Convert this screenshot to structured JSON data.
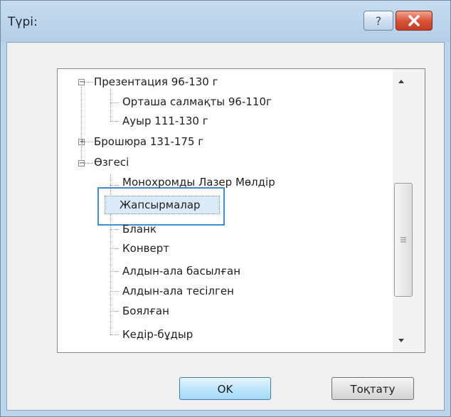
{
  "dialog": {
    "title": "Түрі:",
    "help_label": "?",
    "close_icon": "close-x-icon"
  },
  "tree": {
    "nodes": [
      {
        "label": "Презентация 96-130 г",
        "expander": "−"
      },
      {
        "label": "Орташа салмақты 96-110г"
      },
      {
        "label": "Ауыр 111-130 г"
      },
      {
        "label": "Брошюра 131-175 г",
        "expander": "+"
      },
      {
        "label": "Өзгесі",
        "expander": "−"
      },
      {
        "label": "Монохромды Лазер Мөлдір"
      },
      {
        "label": "Жапсырмалар",
        "selected": true
      },
      {
        "label": "Бланк"
      },
      {
        "label": "Конверт"
      },
      {
        "label": "Алдын-ала басылған"
      },
      {
        "label": "Алдын-ала тесілген"
      },
      {
        "label": "Боялған"
      },
      {
        "label": "Кедір-бұдыр"
      }
    ]
  },
  "scrollbar": {
    "up_icon": "scroll-up-arrow-icon",
    "down_icon": "scroll-down-arrow-icon",
    "grip_icon": "scroll-grip-icon"
  },
  "buttons": {
    "ok_label": "OK",
    "cancel_label": "Тоқтату"
  },
  "colors": {
    "titlebar": "#bcd4ec",
    "close_button": "#d9553a",
    "selection_border": "#3f8fd2",
    "ok_button": "#bee6fd"
  }
}
